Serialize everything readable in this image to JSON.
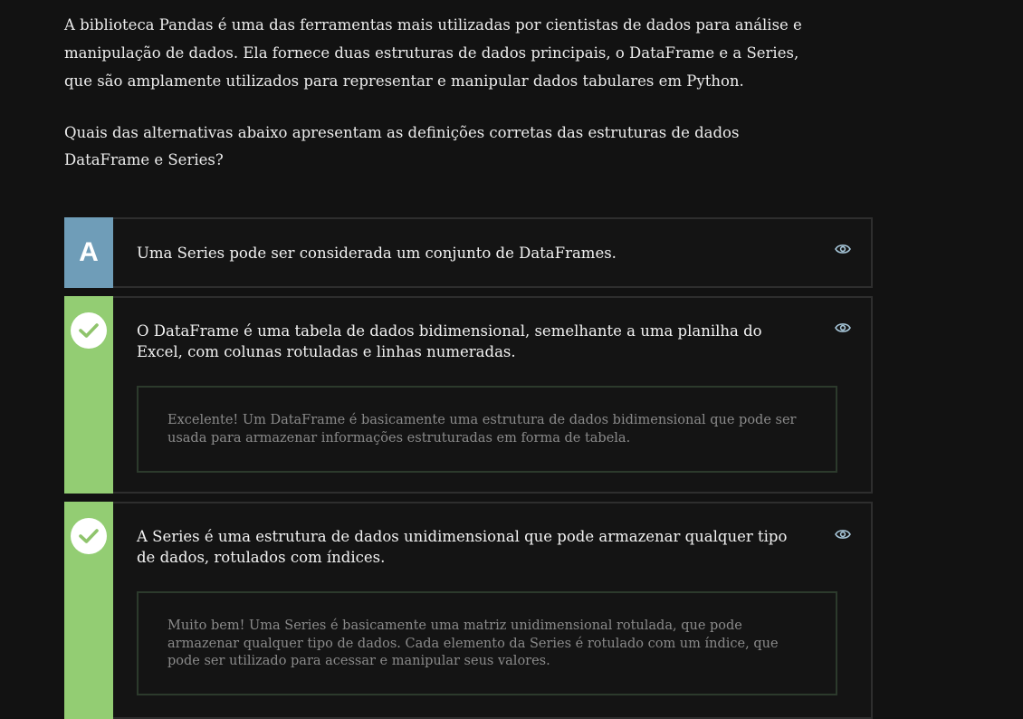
{
  "intro": {
    "paragraph": "A biblioteca Pandas é uma das ferramentas mais utilizadas por cientistas de dados para análise e manipulação de dados. Ela fornece duas estruturas de dados principais, o DataFrame e a Series, que são amplamente utilizados para representar e manipular dados tabulares em Python.",
    "question": "Quais das alternativas abaixo apresentam as definições corretas das estruturas de dados DataFrame e Series?"
  },
  "options": [
    {
      "letter": "A",
      "text": "Uma Series pode ser considerada um conjunto de DataFrames.",
      "state": "unselected",
      "icon": "eye-icon"
    },
    {
      "text": "O DataFrame é uma tabela de dados bidimensional, semelhante a uma planilha do Excel, com colunas rotuladas e linhas numeradas.",
      "state": "correct",
      "icon": "eye-icon",
      "feedback": "Excelente! Um DataFrame é basicamente uma estrutura de dados bidimensional que pode ser usada para armazenar informações estruturadas em forma de tabela."
    },
    {
      "text": "A Series é uma estrutura de dados unidimensional que pode armazenar qualquer tipo de dados, rotulados com índices.",
      "state": "correct",
      "icon": "eye-icon",
      "feedback": "Muito bem! Uma Series é basicamente uma matriz unidimensional rotulada, que pode armazenar qualquer tipo de dados. Cada elemento da Series é rotulado com um índice, que pode ser utilizado para acessar e manipular seus valores."
    }
  ],
  "colors": {
    "background": "#121212",
    "letter_badge": "#6f9db8",
    "correct_badge": "#93cd73",
    "eye_icon": "#a9c9dc"
  }
}
